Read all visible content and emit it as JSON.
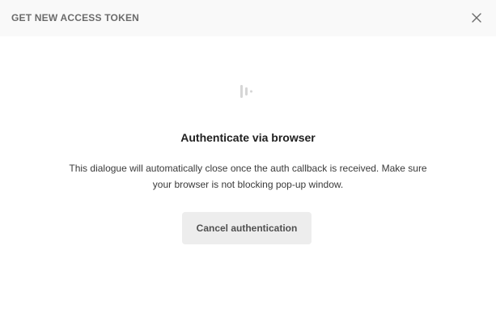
{
  "header": {
    "title": "GET NEW ACCESS TOKEN",
    "close_icon": "close-icon"
  },
  "main": {
    "loader_icon": "loading-bars-icon",
    "title": "Authenticate via browser",
    "description": "This dialogue will automatically close once the auth callback is received. Make sure your browser is not blocking pop-up window.",
    "cancel_label": "Cancel authentication"
  },
  "colors": {
    "header_bg": "#f9f9f9",
    "button_bg": "#ededed",
    "title_text": "#212121",
    "muted_text": "#6b6b6b"
  }
}
